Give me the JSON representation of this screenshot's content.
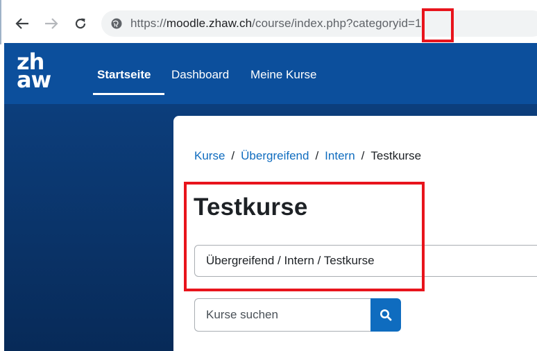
{
  "browser": {
    "url_prefix": "https://",
    "url_host": "moodle.zhaw.ch",
    "url_path": "/course/index.php?categoryid=1",
    "back_icon": "arrow-left-icon",
    "forward_icon": "arrow-right-icon",
    "reload_icon": "reload-icon",
    "site_info_icon": "site-info-icon"
  },
  "navbar": {
    "logo_line1": "zh",
    "logo_line2": "aw",
    "links": [
      {
        "label": "Startseite",
        "active": true
      },
      {
        "label": "Dashboard",
        "active": false
      },
      {
        "label": "Meine Kurse",
        "active": false
      }
    ]
  },
  "breadcrumb": {
    "items": [
      "Kurse",
      "Übergreifend",
      "Intern"
    ],
    "current": "Testkurse",
    "separator": "/"
  },
  "page": {
    "title": "Testkurse",
    "category_select_value": "Übergreifend / Intern / Testkurse",
    "search_placeholder": "Kurse suchen",
    "search_icon": "search-icon"
  },
  "colors": {
    "navbar": "#0c4f9c",
    "link": "#0f6cbf",
    "highlight": "#e8141c",
    "sidebar": "#0a3266"
  }
}
